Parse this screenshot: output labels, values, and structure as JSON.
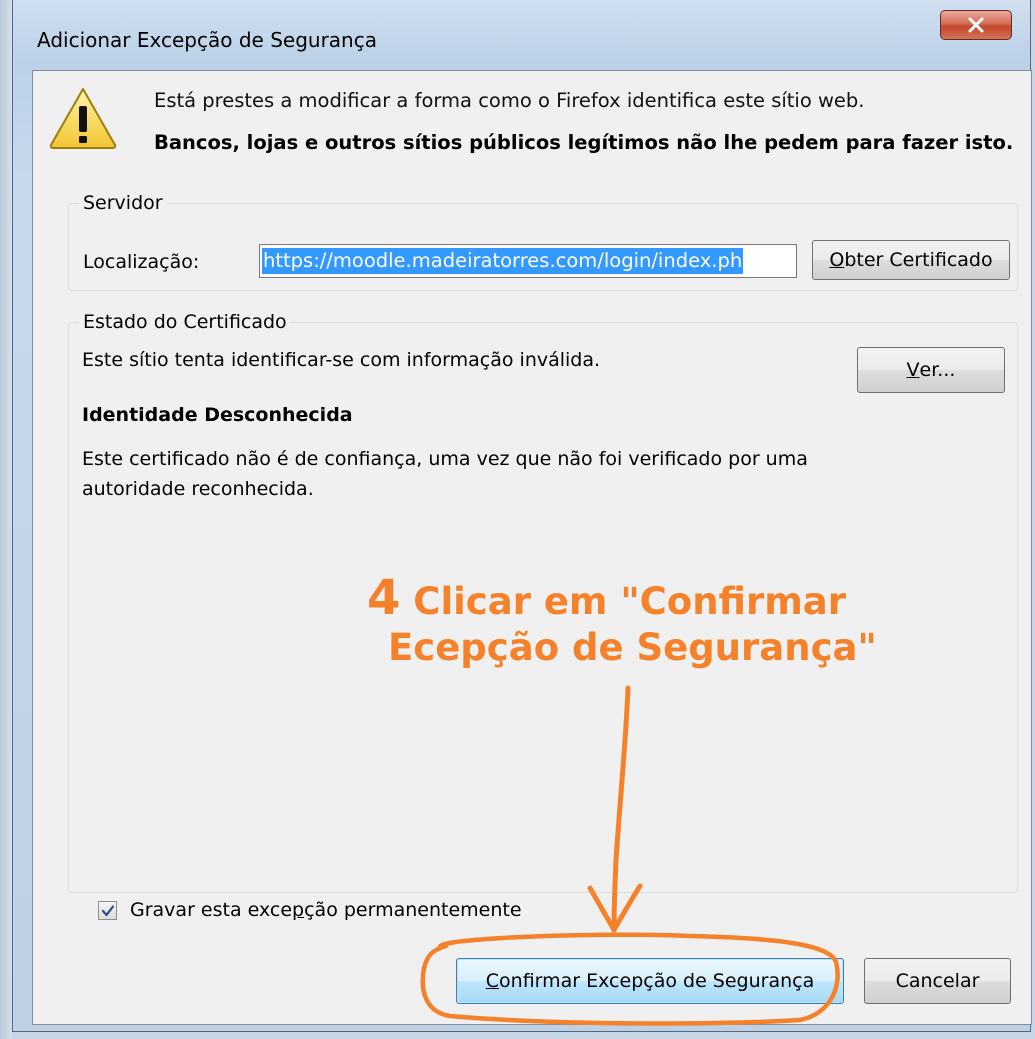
{
  "window": {
    "title": "Adicionar Excepção de Segurança"
  },
  "header": {
    "info_text": "Está prestes a modificar a forma como o Firefox identifica este sítio web.",
    "warning_text": "Bancos, lojas e outros sítios públicos legítimos não lhe pedem para fazer isto."
  },
  "server": {
    "legend": "Servidor",
    "location_label": "Localização:",
    "location_value": "https://moodle.madeiratorres.com/login/index.ph",
    "get_cert_button": {
      "pre": "",
      "accel": "O",
      "post": "bter Certificado"
    }
  },
  "cert_status": {
    "legend": "Estado do Certificado",
    "summary": "Este sítio tenta identificar-se com informação inválida.",
    "view_button": {
      "pre": "",
      "accel": "V",
      "post": "er..."
    },
    "identity_heading": "Identidade Desconhecida",
    "identity_line1": "Este certificado não é de confiança, uma vez que não foi verificado por uma",
    "identity_line2": "autoridade reconhecida."
  },
  "permanent_checkbox": {
    "checked": true,
    "label": {
      "pre": "Gravar esta exce",
      "accel": "p",
      "post": "ção permanentemente"
    }
  },
  "buttons": {
    "confirm": {
      "pre": "",
      "accel": "C",
      "post": "onfirmar Excepção de Segurança"
    },
    "cancel": "Cancelar"
  },
  "annotation": {
    "number": "4",
    "line1": " Clicar em \"Confirmar",
    "line2": "Ecepção de Segurança\"",
    "color": "#f5822a"
  },
  "icons": {
    "warning": "warning-triangle-icon",
    "close": "close-x-icon",
    "checkmark": "checkmark-icon"
  }
}
